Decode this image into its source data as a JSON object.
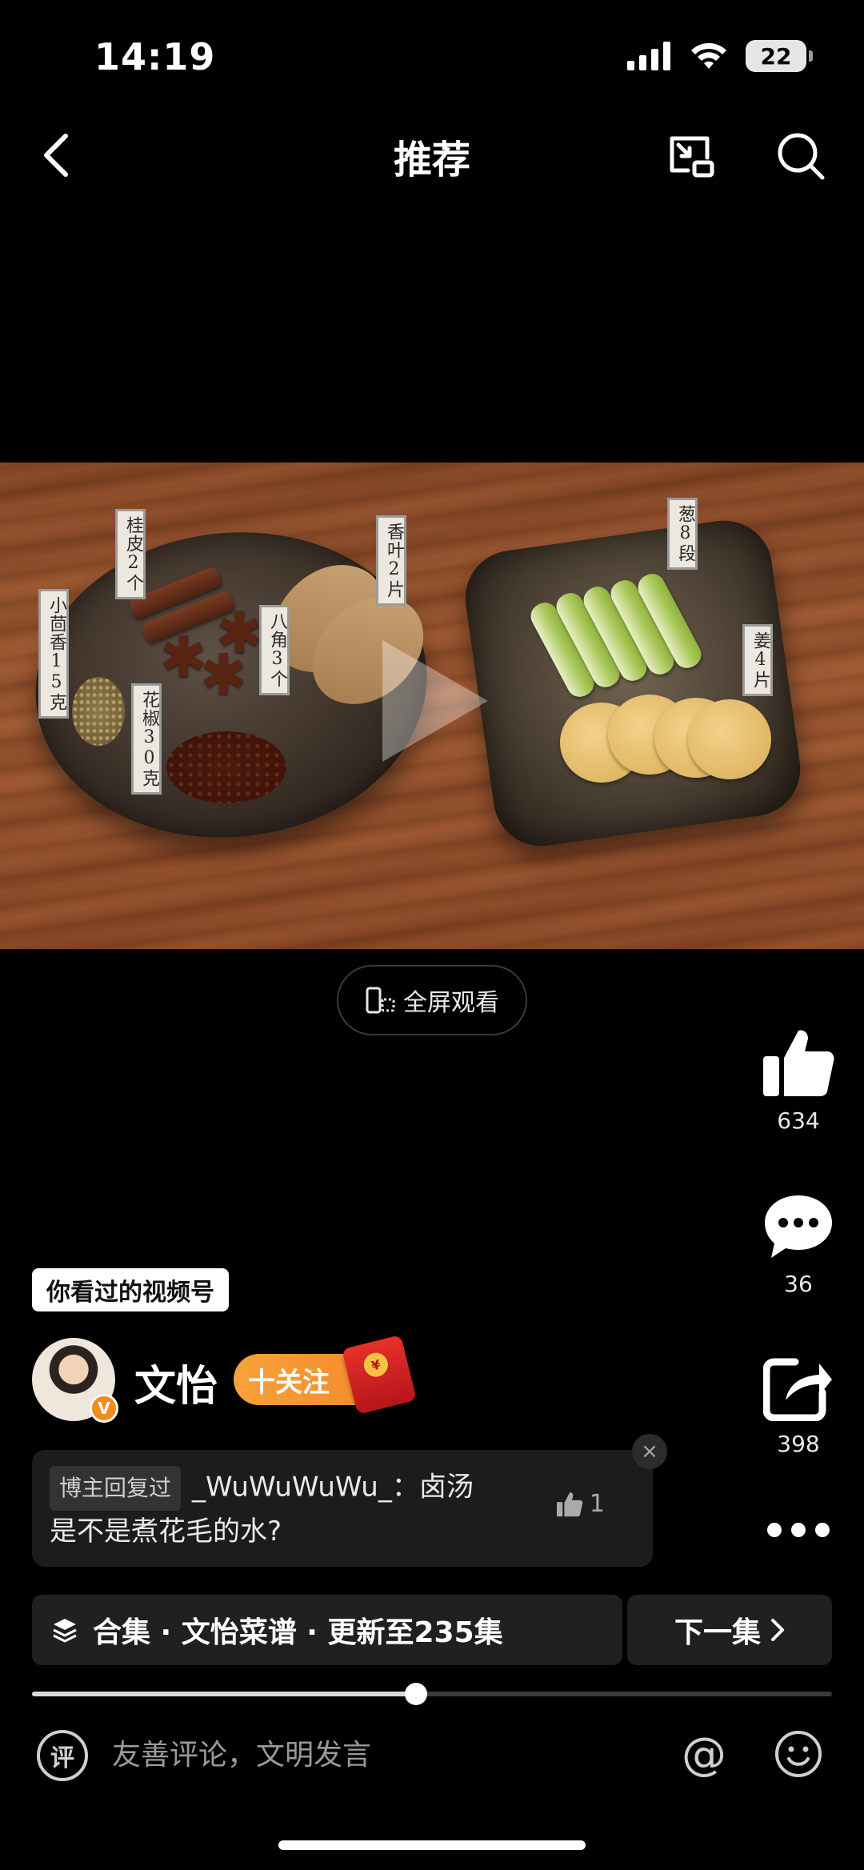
{
  "status_bar": {
    "time": "14:19",
    "battery": "22"
  },
  "nav": {
    "title": "推荐"
  },
  "video": {
    "labels": [
      "桂皮2个",
      "小茴香15克",
      "八角3个",
      "香叶2片",
      "花椒30克",
      "葱8段",
      "姜4片"
    ]
  },
  "fullscreen": {
    "label": "全屏观看"
  },
  "actions": {
    "likes": "634",
    "comments": "36",
    "shares": "398"
  },
  "badge": {
    "label": "你看过的视频号"
  },
  "author": {
    "name": "文怡",
    "verified_mark": "V",
    "follow_label": "十关注"
  },
  "comment": {
    "tag": "博主回复过",
    "user": "_WuWuWuWu_",
    "sep": "：",
    "text_part1": "卤汤",
    "text_part2": "是不是煮花毛的水?",
    "likes": "1",
    "close": "×"
  },
  "collection": {
    "label": "合集 · 文怡菜谱 · 更新至235集",
    "next_label": "下一集"
  },
  "progress": {
    "fraction": 0.48
  },
  "input": {
    "icon_char": "评",
    "placeholder": "友善评论，文明发言"
  },
  "colors": {
    "follow": "#f4882a",
    "background": "#000000"
  }
}
